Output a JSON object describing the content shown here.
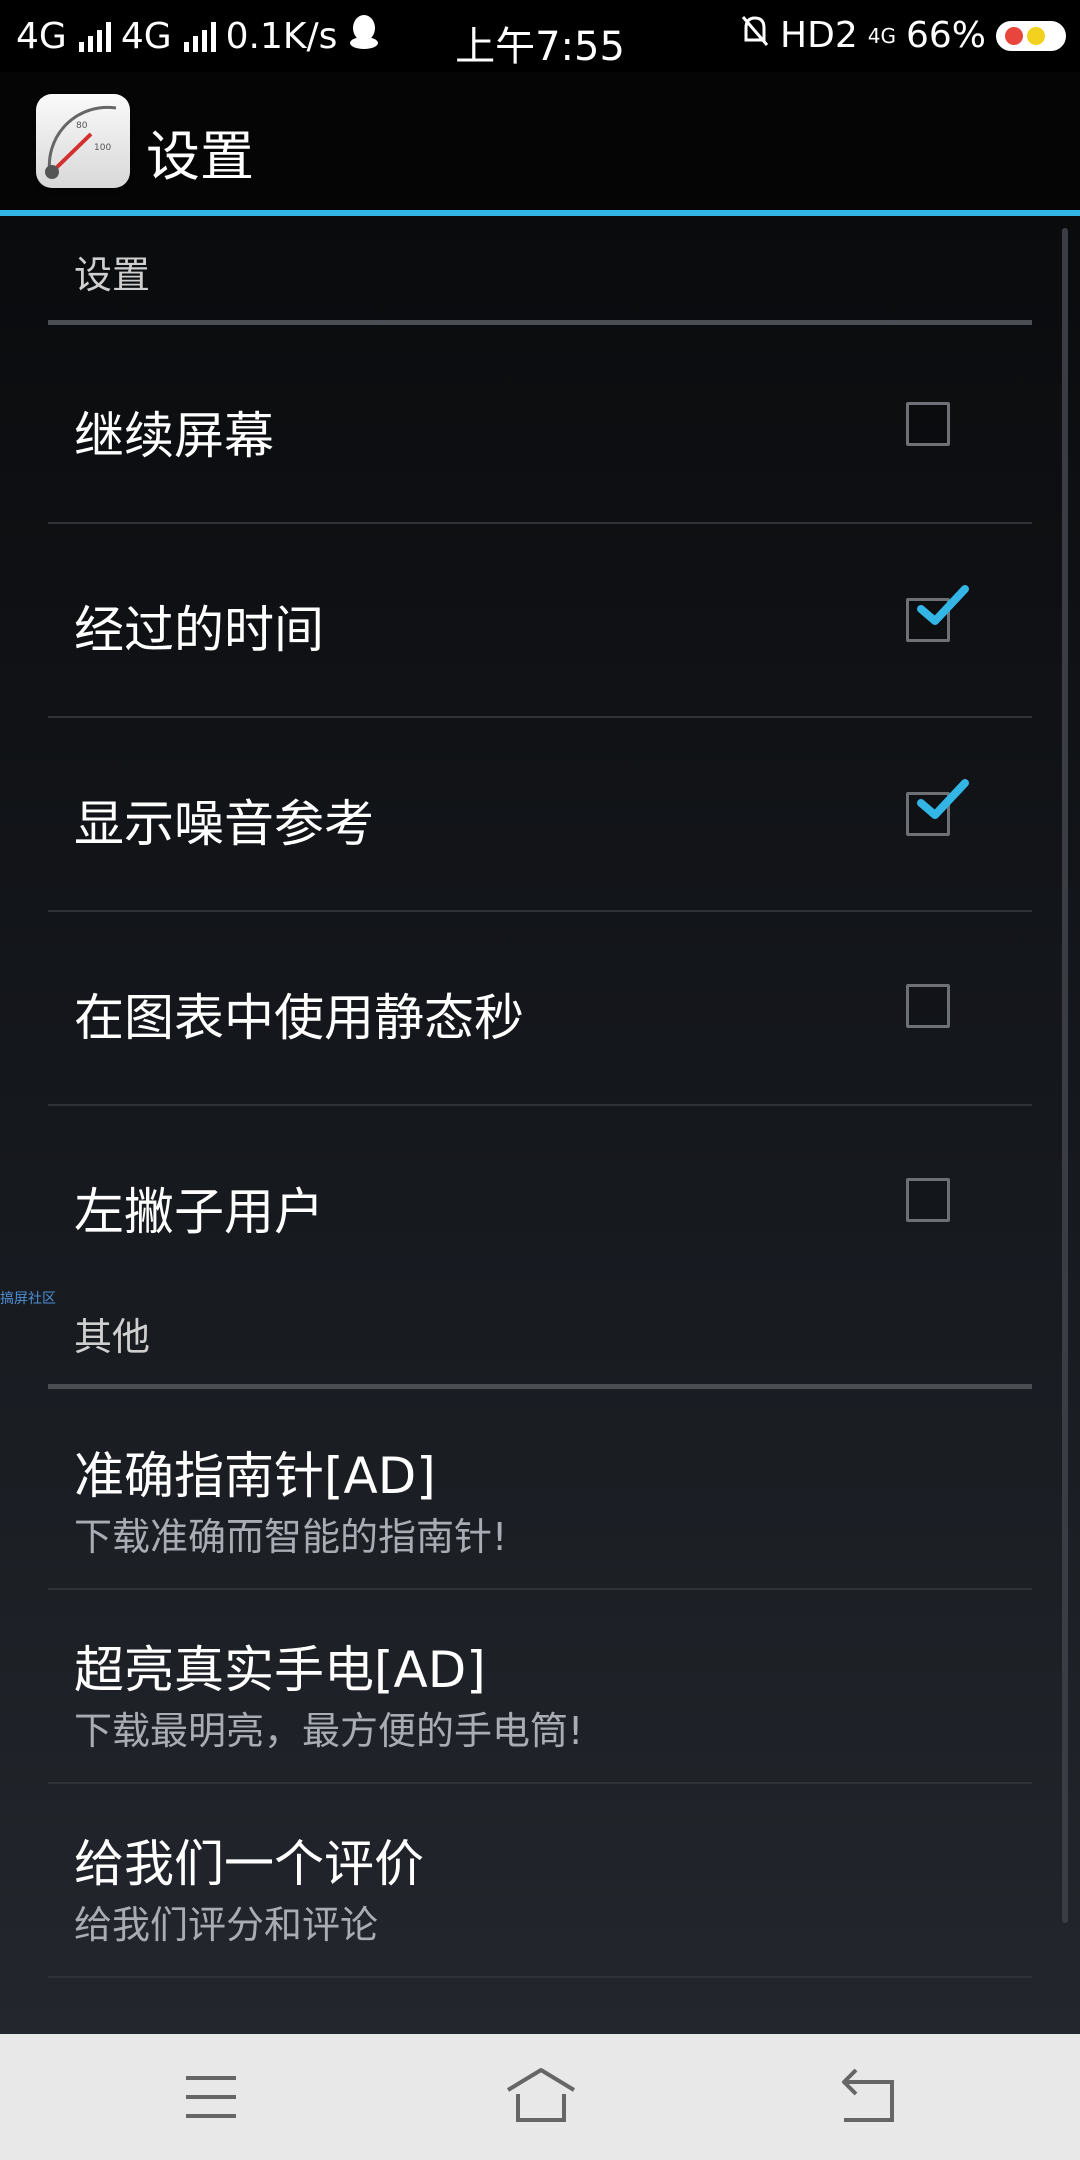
{
  "status_bar": {
    "network_1": "4G",
    "network_2": "4G",
    "speed": "0.1K/s",
    "time": "上午7:55",
    "hd": "HD2",
    "lte": "4G",
    "battery": "66%"
  },
  "action_bar": {
    "title": "设置",
    "icon": "speedometer-icon"
  },
  "settings": {
    "section_title": "设置",
    "items": [
      {
        "label": "继续屏幕",
        "checked": false
      },
      {
        "label": "经过的时间",
        "checked": true
      },
      {
        "label": "显示噪音参考",
        "checked": true
      },
      {
        "label": "在图表中使用静态秒",
        "checked": false
      },
      {
        "label": "左撇子用户",
        "checked": false
      }
    ]
  },
  "other": {
    "section_title": "其他",
    "items": [
      {
        "title": "准确指南针[AD]",
        "subtitle": "下载准确而智能的指南针!"
      },
      {
        "title": "超亮真实手电[AD]",
        "subtitle": "下载最明亮，最方便的手电筒!"
      },
      {
        "title": "给我们一个评价",
        "subtitle": "给我们评分和评论"
      }
    ]
  },
  "watermark": "搞屏社区",
  "nav_bar": {
    "menu_icon": "menu-icon",
    "home_icon": "home-icon",
    "back_icon": "back-icon"
  },
  "colors": {
    "accent": "#33b5e5",
    "check": "#33b5e5"
  }
}
